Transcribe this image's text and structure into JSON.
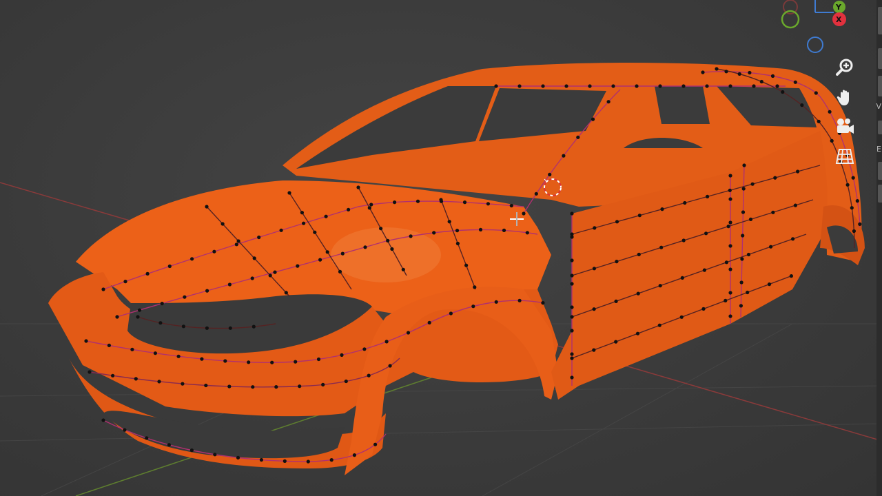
{
  "viewport": {
    "background": "#3d3d3d",
    "mesh_color": "#ea5e14",
    "edge_color": "#d0309a",
    "vertex_color": "#111111"
  },
  "gizmo": {
    "axis_y_label": "Y",
    "axis_x_label": "X",
    "colors": {
      "x": "#e2313e",
      "y": "#6aa82c",
      "z": "#3f7bd1"
    }
  },
  "navigation": {
    "zoom_icon": "magnifier-plus-icon",
    "pan_icon": "hand-icon",
    "camera_icon": "camera-icon",
    "ortho_icon": "grid-plane-icon"
  },
  "side_panel": {
    "letters": [
      "V",
      "E"
    ]
  }
}
